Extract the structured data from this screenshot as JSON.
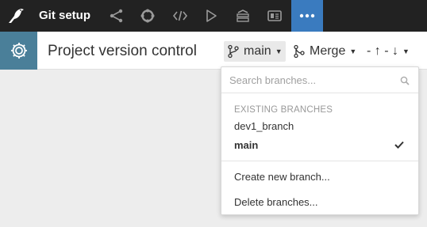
{
  "app": {
    "title": "Git setup",
    "nav_icons": [
      "flow-icon",
      "lifecycle-icon",
      "code-icon",
      "run-icon",
      "stack-icon",
      "dashboard-icon",
      "more-icon"
    ]
  },
  "header": {
    "page_title": "Project version control",
    "branch_label": "main",
    "merge_label": "Merge",
    "sync_label": "- ↑ - ↓"
  },
  "dropdown": {
    "search_placeholder": "Search branches...",
    "section_label": "EXISTING BRANCHES",
    "branches": [
      {
        "name": "dev1_branch",
        "current": false
      },
      {
        "name": "main",
        "current": true
      }
    ],
    "create_label": "Create new branch...",
    "delete_label": "Delete branches..."
  },
  "colors": {
    "topbar": "#222222",
    "accent_blue": "#3a7bbf",
    "settings_tile": "#4a7f99"
  }
}
